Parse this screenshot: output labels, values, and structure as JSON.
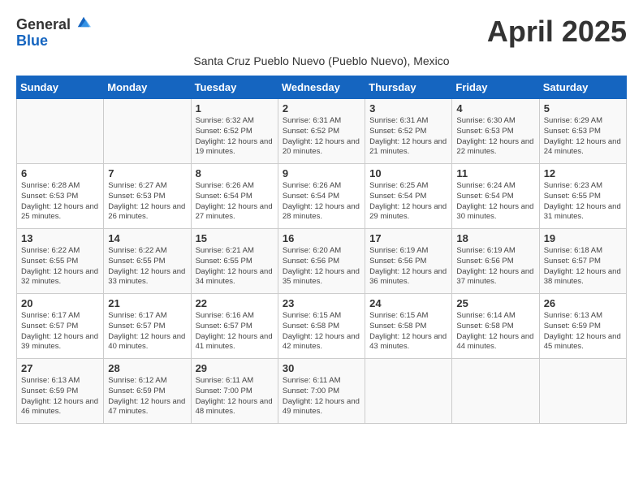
{
  "header": {
    "logo_general": "General",
    "logo_blue": "Blue",
    "month_title": "April 2025",
    "subtitle": "Santa Cruz Pueblo Nuevo (Pueblo Nuevo), Mexico"
  },
  "days_of_week": [
    "Sunday",
    "Monday",
    "Tuesday",
    "Wednesday",
    "Thursday",
    "Friday",
    "Saturday"
  ],
  "weeks": [
    [
      {
        "day": "",
        "sunrise": "",
        "sunset": "",
        "daylight": ""
      },
      {
        "day": "",
        "sunrise": "",
        "sunset": "",
        "daylight": ""
      },
      {
        "day": "1",
        "sunrise": "Sunrise: 6:32 AM",
        "sunset": "Sunset: 6:52 PM",
        "daylight": "Daylight: 12 hours and 19 minutes."
      },
      {
        "day": "2",
        "sunrise": "Sunrise: 6:31 AM",
        "sunset": "Sunset: 6:52 PM",
        "daylight": "Daylight: 12 hours and 20 minutes."
      },
      {
        "day": "3",
        "sunrise": "Sunrise: 6:31 AM",
        "sunset": "Sunset: 6:52 PM",
        "daylight": "Daylight: 12 hours and 21 minutes."
      },
      {
        "day": "4",
        "sunrise": "Sunrise: 6:30 AM",
        "sunset": "Sunset: 6:53 PM",
        "daylight": "Daylight: 12 hours and 22 minutes."
      },
      {
        "day": "5",
        "sunrise": "Sunrise: 6:29 AM",
        "sunset": "Sunset: 6:53 PM",
        "daylight": "Daylight: 12 hours and 24 minutes."
      }
    ],
    [
      {
        "day": "6",
        "sunrise": "Sunrise: 6:28 AM",
        "sunset": "Sunset: 6:53 PM",
        "daylight": "Daylight: 12 hours and 25 minutes."
      },
      {
        "day": "7",
        "sunrise": "Sunrise: 6:27 AM",
        "sunset": "Sunset: 6:53 PM",
        "daylight": "Daylight: 12 hours and 26 minutes."
      },
      {
        "day": "8",
        "sunrise": "Sunrise: 6:26 AM",
        "sunset": "Sunset: 6:54 PM",
        "daylight": "Daylight: 12 hours and 27 minutes."
      },
      {
        "day": "9",
        "sunrise": "Sunrise: 6:26 AM",
        "sunset": "Sunset: 6:54 PM",
        "daylight": "Daylight: 12 hours and 28 minutes."
      },
      {
        "day": "10",
        "sunrise": "Sunrise: 6:25 AM",
        "sunset": "Sunset: 6:54 PM",
        "daylight": "Daylight: 12 hours and 29 minutes."
      },
      {
        "day": "11",
        "sunrise": "Sunrise: 6:24 AM",
        "sunset": "Sunset: 6:54 PM",
        "daylight": "Daylight: 12 hours and 30 minutes."
      },
      {
        "day": "12",
        "sunrise": "Sunrise: 6:23 AM",
        "sunset": "Sunset: 6:55 PM",
        "daylight": "Daylight: 12 hours and 31 minutes."
      }
    ],
    [
      {
        "day": "13",
        "sunrise": "Sunrise: 6:22 AM",
        "sunset": "Sunset: 6:55 PM",
        "daylight": "Daylight: 12 hours and 32 minutes."
      },
      {
        "day": "14",
        "sunrise": "Sunrise: 6:22 AM",
        "sunset": "Sunset: 6:55 PM",
        "daylight": "Daylight: 12 hours and 33 minutes."
      },
      {
        "day": "15",
        "sunrise": "Sunrise: 6:21 AM",
        "sunset": "Sunset: 6:55 PM",
        "daylight": "Daylight: 12 hours and 34 minutes."
      },
      {
        "day": "16",
        "sunrise": "Sunrise: 6:20 AM",
        "sunset": "Sunset: 6:56 PM",
        "daylight": "Daylight: 12 hours and 35 minutes."
      },
      {
        "day": "17",
        "sunrise": "Sunrise: 6:19 AM",
        "sunset": "Sunset: 6:56 PM",
        "daylight": "Daylight: 12 hours and 36 minutes."
      },
      {
        "day": "18",
        "sunrise": "Sunrise: 6:19 AM",
        "sunset": "Sunset: 6:56 PM",
        "daylight": "Daylight: 12 hours and 37 minutes."
      },
      {
        "day": "19",
        "sunrise": "Sunrise: 6:18 AM",
        "sunset": "Sunset: 6:57 PM",
        "daylight": "Daylight: 12 hours and 38 minutes."
      }
    ],
    [
      {
        "day": "20",
        "sunrise": "Sunrise: 6:17 AM",
        "sunset": "Sunset: 6:57 PM",
        "daylight": "Daylight: 12 hours and 39 minutes."
      },
      {
        "day": "21",
        "sunrise": "Sunrise: 6:17 AM",
        "sunset": "Sunset: 6:57 PM",
        "daylight": "Daylight: 12 hours and 40 minutes."
      },
      {
        "day": "22",
        "sunrise": "Sunrise: 6:16 AM",
        "sunset": "Sunset: 6:57 PM",
        "daylight": "Daylight: 12 hours and 41 minutes."
      },
      {
        "day": "23",
        "sunrise": "Sunrise: 6:15 AM",
        "sunset": "Sunset: 6:58 PM",
        "daylight": "Daylight: 12 hours and 42 minutes."
      },
      {
        "day": "24",
        "sunrise": "Sunrise: 6:15 AM",
        "sunset": "Sunset: 6:58 PM",
        "daylight": "Daylight: 12 hours and 43 minutes."
      },
      {
        "day": "25",
        "sunrise": "Sunrise: 6:14 AM",
        "sunset": "Sunset: 6:58 PM",
        "daylight": "Daylight: 12 hours and 44 minutes."
      },
      {
        "day": "26",
        "sunrise": "Sunrise: 6:13 AM",
        "sunset": "Sunset: 6:59 PM",
        "daylight": "Daylight: 12 hours and 45 minutes."
      }
    ],
    [
      {
        "day": "27",
        "sunrise": "Sunrise: 6:13 AM",
        "sunset": "Sunset: 6:59 PM",
        "daylight": "Daylight: 12 hours and 46 minutes."
      },
      {
        "day": "28",
        "sunrise": "Sunrise: 6:12 AM",
        "sunset": "Sunset: 6:59 PM",
        "daylight": "Daylight: 12 hours and 47 minutes."
      },
      {
        "day": "29",
        "sunrise": "Sunrise: 6:11 AM",
        "sunset": "Sunset: 7:00 PM",
        "daylight": "Daylight: 12 hours and 48 minutes."
      },
      {
        "day": "30",
        "sunrise": "Sunrise: 6:11 AM",
        "sunset": "Sunset: 7:00 PM",
        "daylight": "Daylight: 12 hours and 49 minutes."
      },
      {
        "day": "",
        "sunrise": "",
        "sunset": "",
        "daylight": ""
      },
      {
        "day": "",
        "sunrise": "",
        "sunset": "",
        "daylight": ""
      },
      {
        "day": "",
        "sunrise": "",
        "sunset": "",
        "daylight": ""
      }
    ]
  ]
}
